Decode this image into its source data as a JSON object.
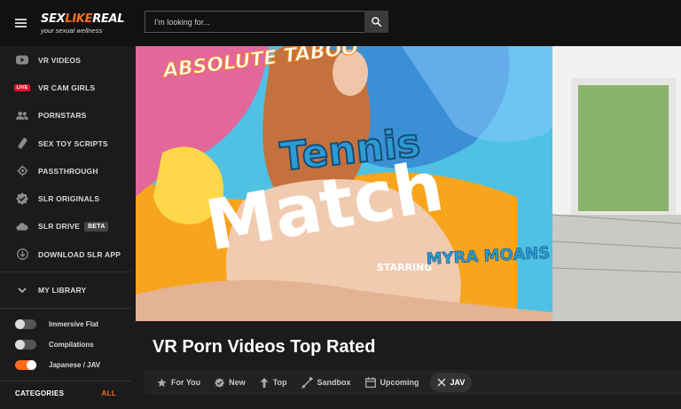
{
  "header": {
    "logo_brand_a": "SEX",
    "logo_brand_b": "LIKE",
    "logo_brand_c": "REAL",
    "logo_tagline": "your sexual wellness",
    "search_placeholder": "I'm looking for..."
  },
  "sidebar": {
    "items": [
      {
        "label": "VR VIDEOS",
        "icon": "youtube-icon"
      },
      {
        "label": "VR CAM GIRLS",
        "icon": "live-badge-icon",
        "badge": "LIVE"
      },
      {
        "label": "PORNSTARS",
        "icon": "people-icon"
      },
      {
        "label": "SEX TOY SCRIPTS",
        "icon": "device-icon"
      },
      {
        "label": "PASSTHROUGH",
        "icon": "passthrough-icon"
      },
      {
        "label": "SLR ORIGINALS",
        "icon": "verified-badge-icon"
      },
      {
        "label": "SLR DRIVE",
        "icon": "cloud-icon",
        "badge": "BETA"
      },
      {
        "label": "DOWNLOAD SLR APP",
        "icon": "download-icon"
      }
    ],
    "library_label": "MY LIBRARY",
    "toggles": [
      {
        "label": "Immersive Flat",
        "on": false
      },
      {
        "label": "Compilations",
        "on": false
      },
      {
        "label": "Japanese / JAV",
        "on": true
      }
    ],
    "categories_label": "CATEGORIES",
    "categories_all": "ALL"
  },
  "banner": {
    "top_text": "ABSOLUTE TABOO",
    "title_line1": "Tennis",
    "title_line2": "Match",
    "starring_label": "STARRING",
    "starring_name": "MYRA MOANS"
  },
  "main": {
    "title": "VR Porn Videos Top Rated",
    "tabs": [
      {
        "label": "For You",
        "icon": "star-icon"
      },
      {
        "label": "New",
        "icon": "check-badge-icon"
      },
      {
        "label": "Top",
        "icon": "arrow-up-icon"
      },
      {
        "label": "Sandbox",
        "icon": "shovel-icon"
      },
      {
        "label": "Upcoming",
        "icon": "calendar-icon"
      },
      {
        "label": "JAV",
        "icon": "close-icon",
        "active": true
      }
    ]
  },
  "colors": {
    "accent": "#ff6b1a",
    "live": "#e0102a",
    "background": "#1b1b1b"
  }
}
